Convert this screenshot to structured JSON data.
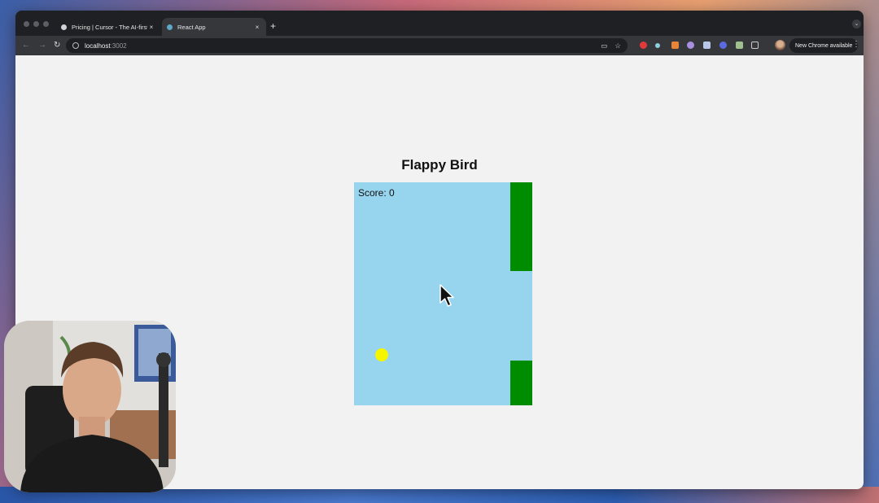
{
  "browser": {
    "tabs": [
      {
        "title": "Pricing | Cursor - The AI-first",
        "close": "×",
        "active": false
      },
      {
        "title": "React App",
        "close": "×",
        "active": true
      }
    ],
    "new_tab_label": "+",
    "tab_search_label": "⌄",
    "url_host": "localhost",
    "url_port": ":3002",
    "update_button": "New Chrome available",
    "menu_label": "⋮",
    "nav": {
      "back": "←",
      "forward": "→",
      "reload": "↻"
    }
  },
  "game": {
    "title": "Flappy Bird",
    "score_text": "Score: 0"
  },
  "colors": {
    "sky": "#97d4ee",
    "pipe": "#008c00",
    "bird": "#f5f500",
    "page_bg": "#f2f2f2"
  }
}
